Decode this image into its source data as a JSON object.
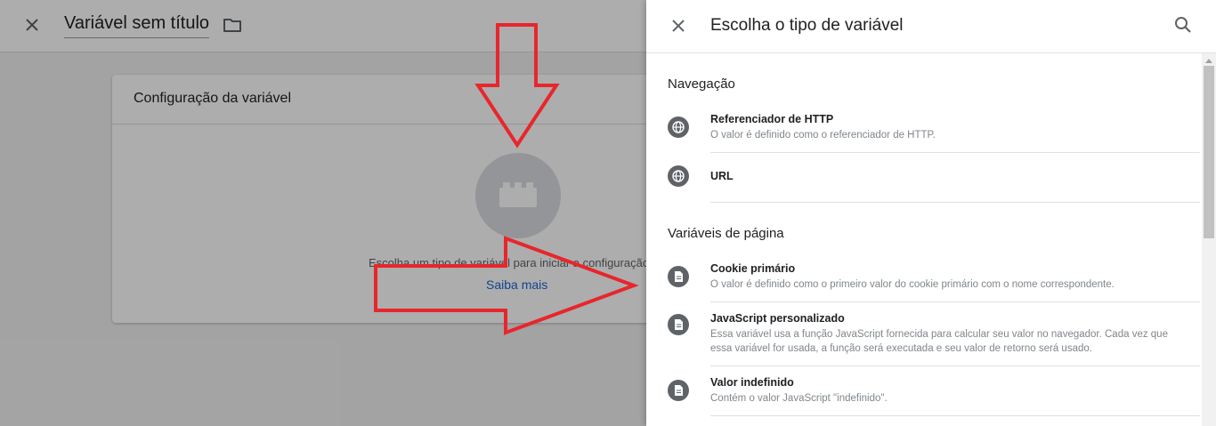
{
  "editor": {
    "title": "Variável sem título",
    "config_title": "Configuração da variável",
    "hint": "Escolha um tipo de variável para iniciar a configuração...",
    "learn_more": "Saiba mais"
  },
  "panel": {
    "title": "Escolha o tipo de variável",
    "sections": [
      {
        "title": "Navegação",
        "items": [
          {
            "name": "Referenciador de HTTP",
            "description": "O valor é definido como o referenciador de HTTP.",
            "icon": "globe-icon"
          },
          {
            "name": "URL",
            "description": "",
            "icon": "globe-icon"
          }
        ]
      },
      {
        "title": "Variáveis de página",
        "items": [
          {
            "name": "Cookie primário",
            "description": "O valor é definido como o primeiro valor do cookie primário com o nome correspondente.",
            "icon": "document-icon"
          },
          {
            "name": "JavaScript personalizado",
            "description": "Essa variável usa a função JavaScript fornecida para calcular seu valor no navegador. Cada vez que essa variável for usada, a função será executada e seu valor de retorno será usado.",
            "icon": "document-icon"
          },
          {
            "name": "Valor indefinido",
            "description": "Contém o valor JavaScript \"indefinido\".",
            "icon": "document-icon"
          }
        ]
      }
    ]
  },
  "colors": {
    "annotation_arrow": "#e8262b",
    "link": "#1967d2",
    "icon_gray": "#5f6368",
    "overlay": "rgba(0,0,0,0.32)"
  }
}
